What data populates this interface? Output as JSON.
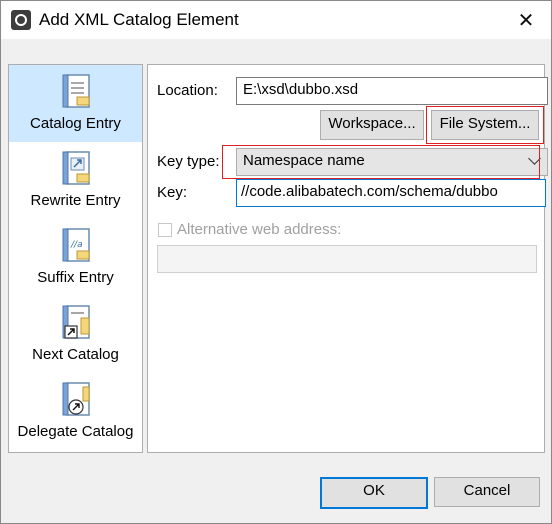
{
  "window": {
    "title": "Add XML Catalog Element",
    "close_glyph": "✕"
  },
  "nav": {
    "items": [
      {
        "label": "Catalog Entry",
        "icon": "catalog-entry-icon",
        "selected": true
      },
      {
        "label": "Rewrite Entry",
        "icon": "rewrite-entry-icon"
      },
      {
        "label": "Suffix Entry",
        "icon": "suffix-entry-icon"
      },
      {
        "label": "Next Catalog",
        "icon": "next-catalog-icon"
      },
      {
        "label": "Delegate Catalog",
        "icon": "delegate-catalog-icon"
      }
    ]
  },
  "form": {
    "location_label": "Location:",
    "location_value": "E:\\xsd\\dubbo.xsd",
    "workspace_button": "Workspace...",
    "file_system_button": "File System...",
    "key_type_label": "Key type:",
    "key_type_value": "Namespace name",
    "key_label": "Key:",
    "key_value": "//code.alibabatech.com/schema/dubbo",
    "alt_web_label": "Alternative web address:",
    "alt_web_value": "",
    "alt_web_checked": false
  },
  "footer": {
    "ok_button": "OK",
    "cancel_button": "Cancel"
  },
  "colors": {
    "selection": "#cde8ff",
    "focus_border": "#0078d7",
    "highlight_box": "#e02020"
  }
}
